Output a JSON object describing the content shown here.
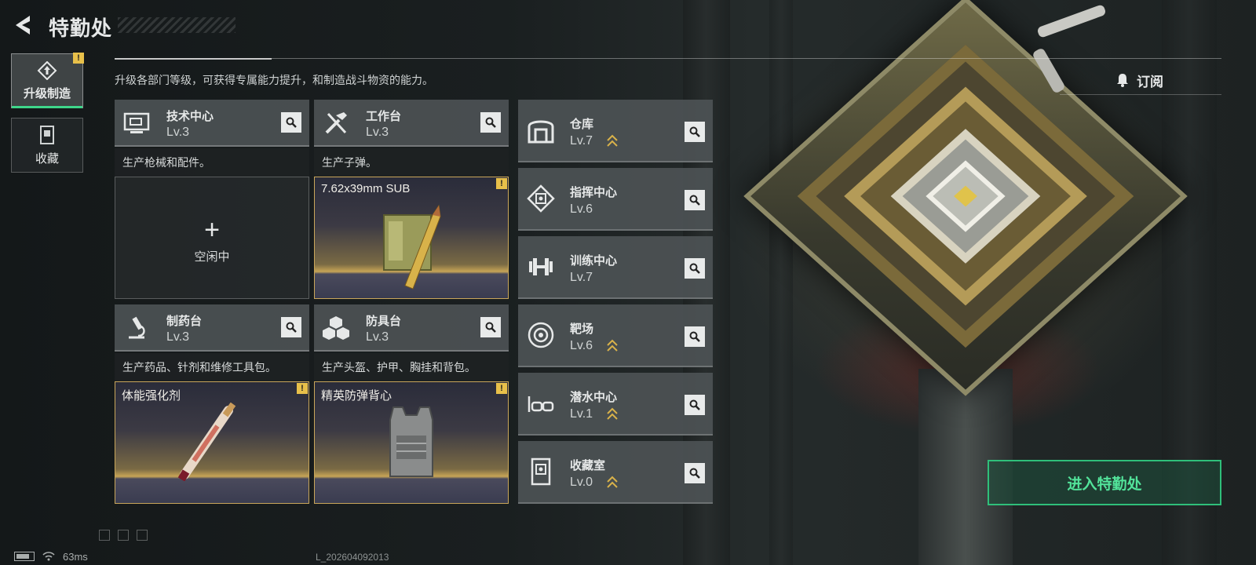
{
  "header": {
    "title": "特勤处"
  },
  "tabs": [
    {
      "label": "升级制造",
      "icon": "upgrade-icon",
      "active": true,
      "warning": "!"
    },
    {
      "label": "收藏",
      "icon": "collection-icon",
      "active": false
    }
  ],
  "description": "升级各部门等级，可获得专属能力提升，和制造战斗物资的能力。",
  "subscribe": {
    "label": "订阅",
    "icon": "bell-icon"
  },
  "production": [
    {
      "name": "技术中心",
      "level": "Lv.3",
      "icon": "monitor-icon",
      "desc": "生产枪械和配件。",
      "slot": {
        "state": "idle",
        "plus": "+",
        "label": "空闲中"
      }
    },
    {
      "name": "工作台",
      "level": "Lv.3",
      "icon": "tools-icon",
      "desc": "生产子弹。",
      "slot": {
        "state": "active",
        "label": "7.62x39mm SUB",
        "warning": "!"
      }
    },
    {
      "name": "制药台",
      "level": "Lv.3",
      "icon": "microscope-icon",
      "desc": "生产药品、针剂和维修工具包。",
      "slot": {
        "state": "active",
        "label": "体能强化剂",
        "warning": "!"
      }
    },
    {
      "name": "防具台",
      "level": "Lv.3",
      "icon": "armor-blocks-icon",
      "desc": "生产头盔、护甲、胸挂和背包。",
      "slot": {
        "state": "active",
        "label": "精英防弹背心",
        "warning": "!"
      }
    }
  ],
  "facilities": [
    {
      "name": "仓库",
      "level": "Lv.7",
      "icon": "warehouse-icon",
      "upgradable": true
    },
    {
      "name": "指挥中心",
      "level": "Lv.6",
      "icon": "chip-icon",
      "upgradable": false
    },
    {
      "name": "训练中心",
      "level": "Lv.7",
      "icon": "dumbbell-icon",
      "upgradable": false
    },
    {
      "name": "靶场",
      "level": "Lv.6",
      "icon": "target-icon",
      "upgradable": true
    },
    {
      "name": "潜水中心",
      "level": "Lv.1",
      "icon": "diving-mask-icon",
      "upgradable": true
    },
    {
      "name": "收藏室",
      "level": "Lv.0",
      "icon": "collection-room-icon",
      "upgradable": true
    }
  ],
  "enter_button": {
    "label": "进入特勤处"
  },
  "status_bar": {
    "ping": "63ms",
    "build": "L_202604092013"
  },
  "colors": {
    "accent_green": "#2fbf7a",
    "warning_yellow": "#e8c04a",
    "gold": "#c9a65a"
  }
}
